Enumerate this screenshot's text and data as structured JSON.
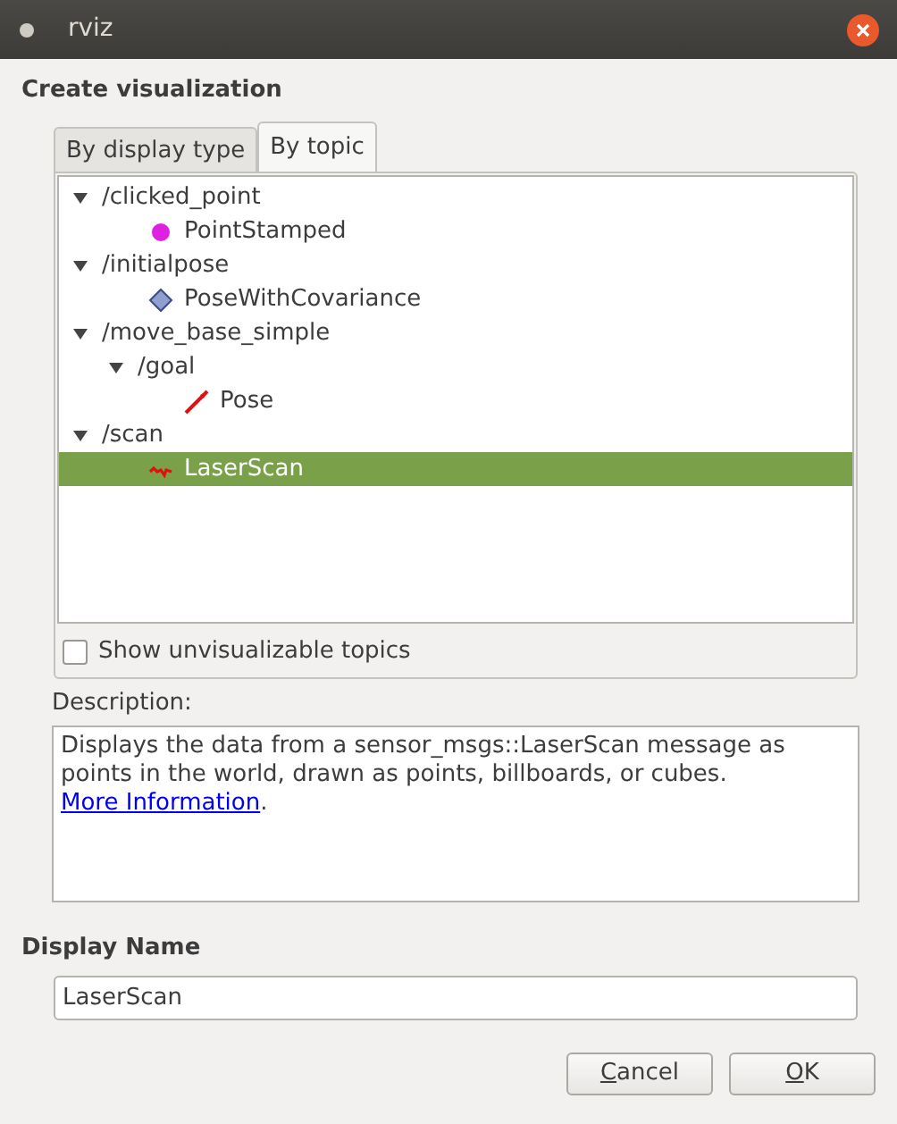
{
  "window": {
    "title": "rviz"
  },
  "heading": "Create visualization",
  "tabs": [
    {
      "label": "By display type",
      "selected": false
    },
    {
      "label": "By topic",
      "selected": true
    }
  ],
  "tree": [
    {
      "label": "/clicked_point",
      "expanded": true,
      "children": [
        {
          "label": "PointStamped",
          "kind": "point",
          "selected": false
        }
      ]
    },
    {
      "label": "/initialpose",
      "expanded": true,
      "children": [
        {
          "label": "PoseWithCovariance",
          "kind": "diamond",
          "selected": false
        }
      ]
    },
    {
      "label": "/move_base_simple",
      "expanded": true,
      "children": [
        {
          "label": "/goal",
          "expanded": true,
          "children": [
            {
              "label": "Pose",
              "kind": "arrow",
              "selected": false
            }
          ]
        }
      ]
    },
    {
      "label": "/scan",
      "expanded": true,
      "children": [
        {
          "label": "LaserScan",
          "kind": "scan",
          "selected": true
        }
      ]
    }
  ],
  "show_unvisualizable": {
    "label": "Show unvisualizable topics",
    "checked": false
  },
  "description": {
    "label": "Description:",
    "text": "Displays the data from a sensor_msgs::LaserScan message as points in the world, drawn as points, billboards, or cubes.",
    "link": "More Information",
    "after": "."
  },
  "display_name": {
    "label": "Display Name",
    "value": "LaserScan"
  },
  "buttons": [
    {
      "mnemonic": "C",
      "rest": "ancel"
    },
    {
      "mnemonic": "O",
      "rest": "K"
    }
  ]
}
